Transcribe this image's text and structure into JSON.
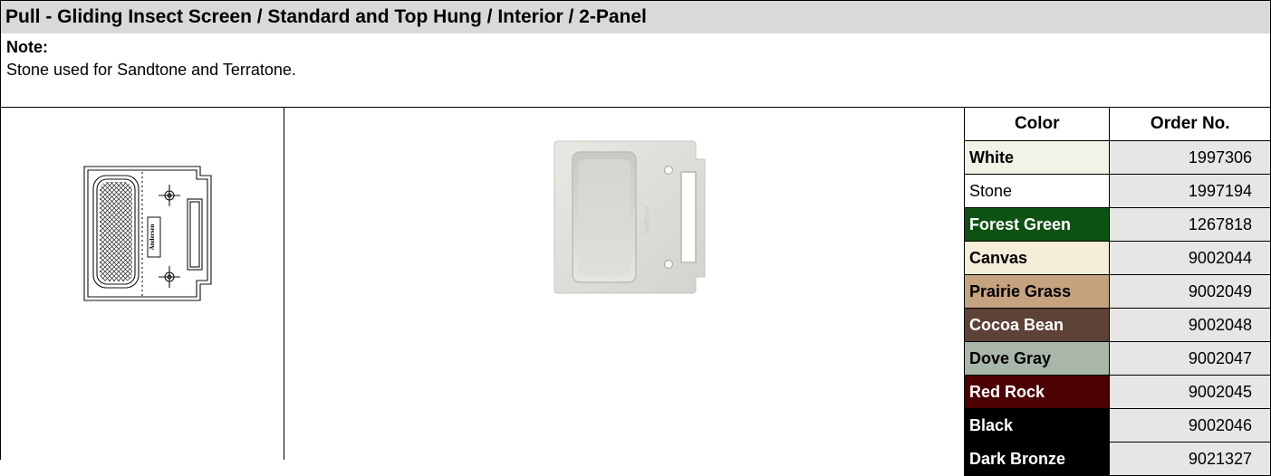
{
  "title": "Pull - Gliding Insect Screen / Standard and Top Hung / Interior / 2-Panel",
  "note": {
    "label": "Note:",
    "text": "Stone used for Sandtone and Terratone."
  },
  "drawing": {
    "brand_text": "Andersen"
  },
  "photo": {
    "brand_text": "Andersen"
  },
  "table": {
    "headers": [
      "Color",
      "Order No."
    ],
    "rows": [
      {
        "color": "White",
        "order": "1997306",
        "swatch": "#f2f2e6",
        "text_color": "#000000",
        "bold": true
      },
      {
        "color": "Stone",
        "order": "1997194",
        "swatch": "#ffffff",
        "text_color": "#000000",
        "bold": false
      },
      {
        "color": "Forest Green",
        "order": "1267818",
        "swatch": "#0e5211",
        "text_color": "#ffffff",
        "bold": true
      },
      {
        "color": "Canvas",
        "order": "9002044",
        "swatch": "#f5edd7",
        "text_color": "#000000",
        "bold": true
      },
      {
        "color": "Prairie Grass",
        "order": "9002049",
        "swatch": "#c5a37f",
        "text_color": "#000000",
        "bold": true
      },
      {
        "color": "Cocoa Bean",
        "order": "9002048",
        "swatch": "#5e4237",
        "text_color": "#ffffff",
        "bold": true
      },
      {
        "color": "Dove Gray",
        "order": "9002047",
        "swatch": "#a9b7ab",
        "text_color": "#000000",
        "bold": true
      },
      {
        "color": "Red Rock",
        "order": "9002045",
        "swatch": "#4d0000",
        "text_color": "#ffffff",
        "bold": true
      },
      {
        "color": "Black",
        "order": "9002046",
        "swatch": "#000000",
        "text_color": "#ffffff",
        "bold": true
      },
      {
        "color": "Dark Bronze",
        "order": "9021327",
        "swatch": "#000000",
        "text_color": "#ffffff",
        "bold": true
      }
    ]
  },
  "colors": {
    "title_bg": "#d9d9d9",
    "order_bg": "#e6e6e6",
    "border": "#000000"
  }
}
